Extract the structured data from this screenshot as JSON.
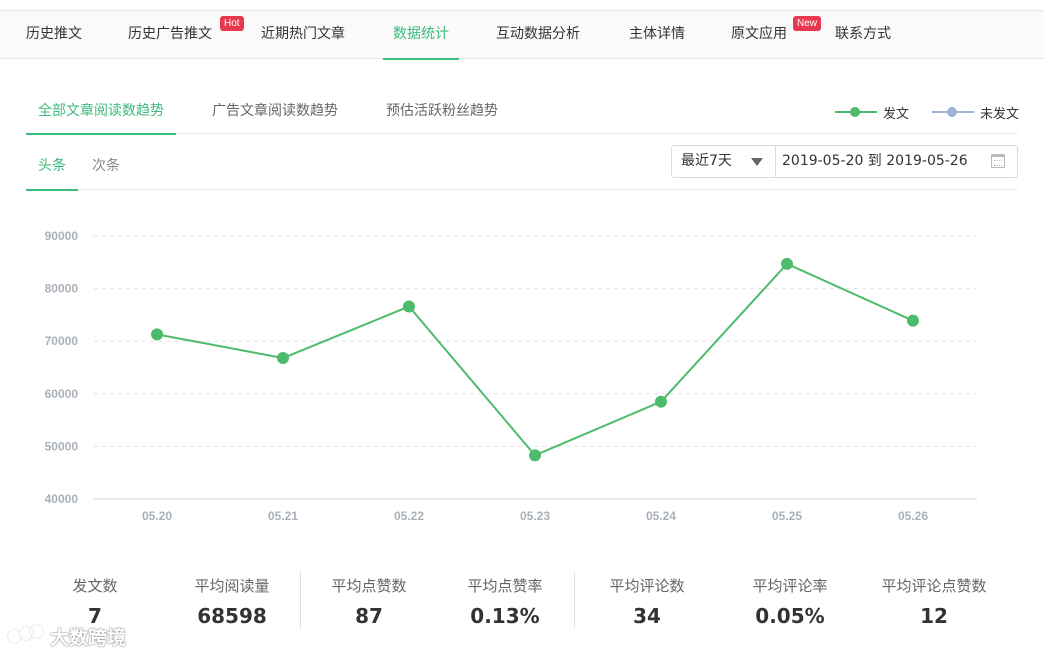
{
  "top_nav": {
    "tabs": [
      {
        "label": "历史推文"
      },
      {
        "label": "历史广告推文",
        "badge": "Hot"
      },
      {
        "label": "近期热门文章"
      },
      {
        "label": "数据统计",
        "active": true
      },
      {
        "label": "互动数据分析"
      },
      {
        "label": "主体详情"
      },
      {
        "label": "原文应用",
        "badge": "New"
      },
      {
        "label": "联系方式"
      }
    ]
  },
  "sub_tabs": [
    {
      "label": "全部文章阅读数趋势",
      "active": true
    },
    {
      "label": "广告文章阅读数趋势"
    },
    {
      "label": "预估活跃粉丝趋势"
    }
  ],
  "legend": [
    {
      "label": "发文",
      "color": "#4cbb6c"
    },
    {
      "label": "未发文",
      "color": "#9eb1d6"
    }
  ],
  "page_tabs": [
    {
      "label": "头条",
      "active": true
    },
    {
      "label": "次条"
    }
  ],
  "date_filter": {
    "preset": "最近7天",
    "range": "2019-05-20 到 2019-05-26"
  },
  "chart_data": {
    "type": "line",
    "x": [
      "05.20",
      "05.21",
      "05.22",
      "05.23",
      "05.24",
      "05.25",
      "05.26"
    ],
    "series": [
      {
        "name": "发文",
        "values": [
          71300,
          66800,
          76600,
          48300,
          58500,
          84700,
          73900
        ],
        "color": "#4cbb6c"
      }
    ],
    "y_ticks": [
      40000,
      50000,
      60000,
      70000,
      80000,
      90000
    ],
    "ylim": [
      40000,
      90000
    ],
    "grid": "horizontal dashed",
    "legend": "top-right"
  },
  "stats": [
    {
      "label": "发文数",
      "value": "7"
    },
    {
      "label": "平均阅读量",
      "value": "68598"
    },
    {
      "label": "平均点赞数",
      "value": "87"
    },
    {
      "label": "平均点赞率",
      "value": "0.13%"
    },
    {
      "label": "平均评论数",
      "value": "34"
    },
    {
      "label": "平均评论率",
      "value": "0.05%"
    },
    {
      "label": "平均评论点赞数",
      "value": "12"
    }
  ],
  "watermark": {
    "text": "大数跨境"
  }
}
